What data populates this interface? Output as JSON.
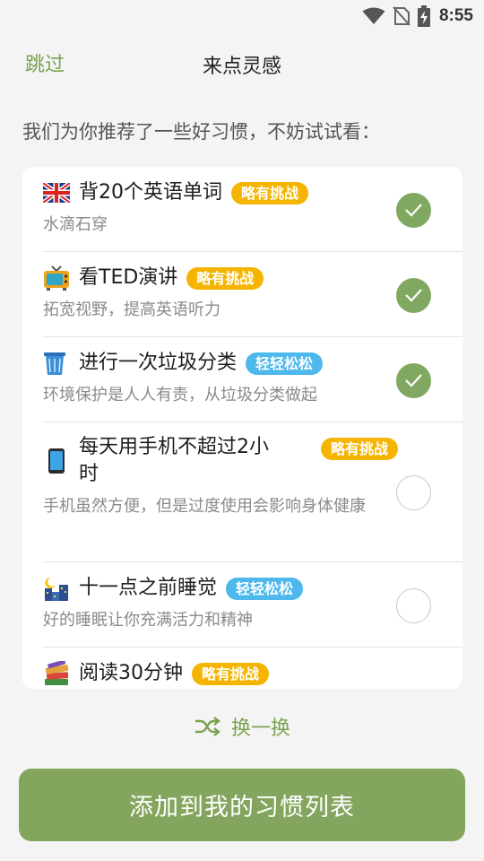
{
  "status_bar": {
    "time": "8:55",
    "icons": [
      "wifi-icon",
      "no-sim-icon",
      "battery-charging-icon"
    ]
  },
  "header": {
    "skip_label": "跳过",
    "title": "来点灵感"
  },
  "subtitle": "我们为你推荐了一些好习惯，不妨试试看：",
  "habits": [
    {
      "icon": "uk-flag-icon",
      "name": "背20个英语单词",
      "badge": "略有挑战",
      "badge_type": "hard",
      "desc": "水滴石穿",
      "checked": true
    },
    {
      "icon": "tv-icon",
      "name": "看TED演讲",
      "badge": "略有挑战",
      "badge_type": "hard",
      "desc": "拓宽视野，提高英语听力",
      "checked": true
    },
    {
      "icon": "trash-can-icon",
      "name": "进行一次垃圾分类",
      "badge": "轻轻松松",
      "badge_type": "easy",
      "desc": "环境保护是人人有责，从垃圾分类做起",
      "checked": true
    },
    {
      "icon": "mobile-phone-icon",
      "name": "每天用手机不超过2小时",
      "badge": "略有挑战",
      "badge_type": "hard",
      "desc": "手机虽然方便，但是过度使用会影响身体健康",
      "checked": false
    },
    {
      "icon": "night-city-icon",
      "name": "十一点之前睡觉",
      "badge": "轻轻松松",
      "badge_type": "easy",
      "desc": "好的睡眠让你充满活力和精神",
      "checked": false
    },
    {
      "icon": "books-icon",
      "name": "阅读30分钟",
      "badge": "略有挑战",
      "badge_type": "hard",
      "desc": "",
      "checked": false
    }
  ],
  "shuffle_label": "换一换",
  "add_button_label": "添加到我的习惯列表",
  "colors": {
    "accent": "#7aa24f",
    "check_on": "#80a860",
    "badge_hard": "#f5b400",
    "badge_easy": "#4cb8ec",
    "button": "#84a55e"
  }
}
